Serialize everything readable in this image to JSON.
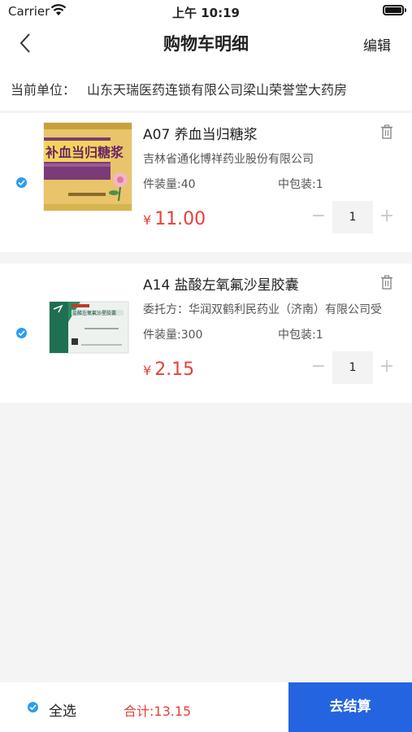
{
  "status_bar": {
    "carrier": "Carrier",
    "time": "上午 10:19"
  },
  "nav": {
    "title": "购物车明细",
    "edit_label": "编辑",
    "back_icon": "chevron-left-icon"
  },
  "unit": {
    "label": "当前单位：",
    "value": "山东天瑞医药连锁有限公司梁山荣誉堂大药房"
  },
  "cart_items": [
    {
      "name": "A07 养血当归糖浆",
      "company": "吉林省通化博祥药业股份有限公司",
      "spec_pack": "件装量:40",
      "spec_mid": "中包装:1",
      "currency": "¥",
      "price": "11.00",
      "quantity": "1",
      "selected": true
    },
    {
      "name": "A14 盐酸左氧氟沙星胶囊",
      "company": "委托方：华润双鹤利民药业（济南）有限公司受",
      "spec_pack": "件装量:300",
      "spec_mid": "中包装:1",
      "currency": "¥",
      "price": "2.15",
      "quantity": "1",
      "selected": true
    }
  ],
  "footer": {
    "select_all_label": "全选",
    "total_label": "合计:13.15",
    "checkout_label": "去结算"
  },
  "colors": {
    "accent_blue": "#2464e0",
    "check_blue": "#2a9df4",
    "price_red": "#e8403a"
  }
}
